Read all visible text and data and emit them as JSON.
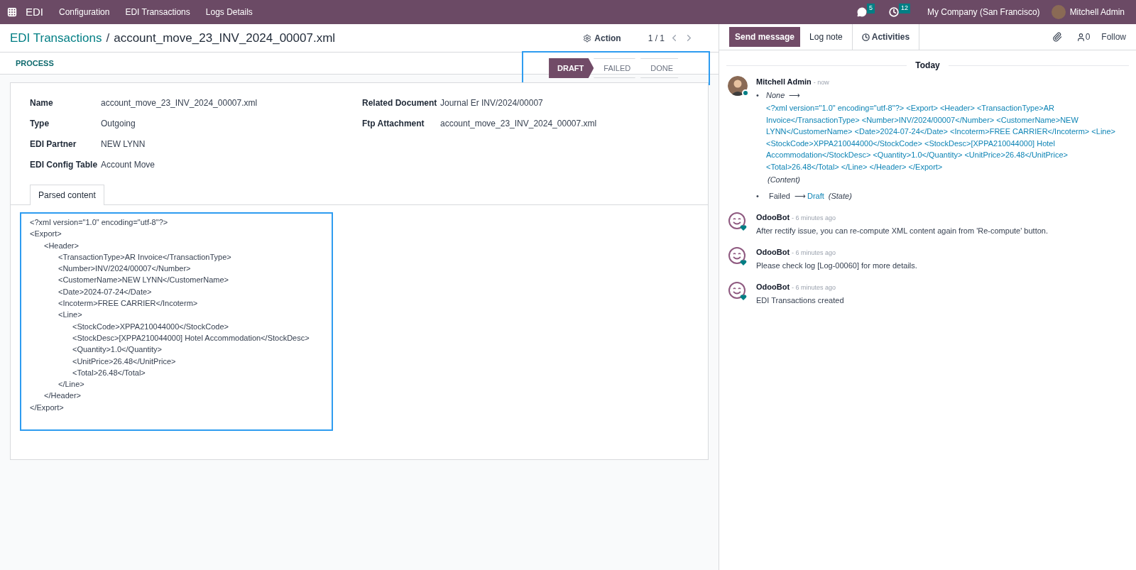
{
  "navbar": {
    "app": "EDI",
    "menus": [
      "Configuration",
      "EDI Transactions",
      "Logs Details"
    ],
    "messages_badge": "5",
    "activities_badge": "12",
    "company": "My Company (San Francisco)",
    "user": "Mitchell Admin"
  },
  "breadcrumb": {
    "parent": "EDI Transactions",
    "separator": "/",
    "current": "account_move_23_INV_2024_00007.xml"
  },
  "action": "Action",
  "pager": "1 / 1",
  "buttons": [
    "PROCESS"
  ],
  "statusbar": [
    {
      "label": "DRAFT",
      "selected": true
    },
    {
      "label": "FAILED",
      "selected": false
    },
    {
      "label": "DONE",
      "selected": false
    }
  ],
  "fields_left": [
    {
      "label": "Name",
      "value": "account_move_23_INV_2024_00007.xml"
    },
    {
      "label": "Type",
      "value": "Outgoing"
    },
    {
      "label": "EDI Partner",
      "value": "NEW LYNN"
    },
    {
      "label": "EDI Config Table",
      "value": "Account Move"
    }
  ],
  "fields_right": [
    {
      "label": "Related Document",
      "value": "Journal Er INV/2024/00007"
    },
    {
      "label": "Ftp Attachment",
      "value": "account_move_23_INV_2024_00007.xml"
    }
  ],
  "tabs": [
    {
      "label": "Parsed content",
      "selected": true
    }
  ],
  "xml": [
    {
      "text": "<?xml version=\"1.0\" encoding=\"utf-8\"?>"
    },
    {
      "text": "<Export>",
      "children": [
        {
          "text": "<Header>",
          "children": [
            {
              "text": "<TransactionType>AR Invoice</TransactionType>"
            },
            {
              "text": "<Number>INV/2024/00007</Number>"
            },
            {
              "text": "<CustomerName>NEW LYNN</CustomerName>"
            },
            {
              "text": "<Date>2024-07-24</Date>"
            },
            {
              "text": "<Incoterm>FREE CARRIER</Incoterm>"
            },
            {
              "text": "<Line>",
              "children": [
                {
                  "text": "<StockCode>XPPA210044000</StockCode>"
                },
                {
                  "text": "<StockDesc>[XPPA210044000] Hotel Accommodation</StockDesc>"
                },
                {
                  "text": "<Quantity>1.0</Quantity>"
                },
                {
                  "text": "<UnitPrice>26.48</UnitPrice>"
                },
                {
                  "text": "<Total>26.48</Total>"
                }
              ]
            },
            {
              "text": "</Line>"
            }
          ]
        },
        {
          "text": "</Header>"
        }
      ]
    },
    {
      "text": "</Export>"
    }
  ],
  "chatter": {
    "bullet": "•",
    "arrow": "⟶",
    "send": "Send message",
    "log": "Log note",
    "activities": "Activities",
    "followers": "0",
    "follow": "Follow",
    "date": "Today",
    "messages": [
      {
        "kind": "tracking",
        "author": "Mitchell Admin",
        "time": "- now",
        "changes": [
          {
            "kind": "block",
            "old": "None",
            "new": "<?xml version=\"1.0\" encoding=\"utf-8\"?> <Export> <Header> <TransactionType>AR Invoice</TransactionType> <Number>INV/2024/00007</Number> <CustomerName>NEW LYNN</CustomerName> <Date>2024-07-24</Date> <Incoterm>FREE CARRIER</Incoterm> <Line> <StockCode>XPPA210044000</StockCode> <StockDesc>[XPPA210044000] Hotel Accommodation</StockDesc> <Quantity>1.0</Quantity> <UnitPrice>26.48</UnitPrice> <Total>26.48</Total> </Line> </Header> </Export>",
            "field": "(Content)"
          },
          {
            "kind": "inline",
            "old": "Failed",
            "new": "Draft",
            "field": "(State)"
          }
        ]
      },
      {
        "kind": "bot",
        "author": "OdooBot",
        "time": "- 6 minutes ago",
        "body": "After rectify issue, you can re-compute XML content again from 'Re-compute' button."
      },
      {
        "kind": "bot",
        "author": "OdooBot",
        "time": "- 6 minutes ago",
        "body": "Please check log [Log-00060] for more details."
      },
      {
        "kind": "bot",
        "author": "OdooBot",
        "time": "- 6 minutes ago",
        "body": "EDI Transactions created"
      }
    ]
  }
}
